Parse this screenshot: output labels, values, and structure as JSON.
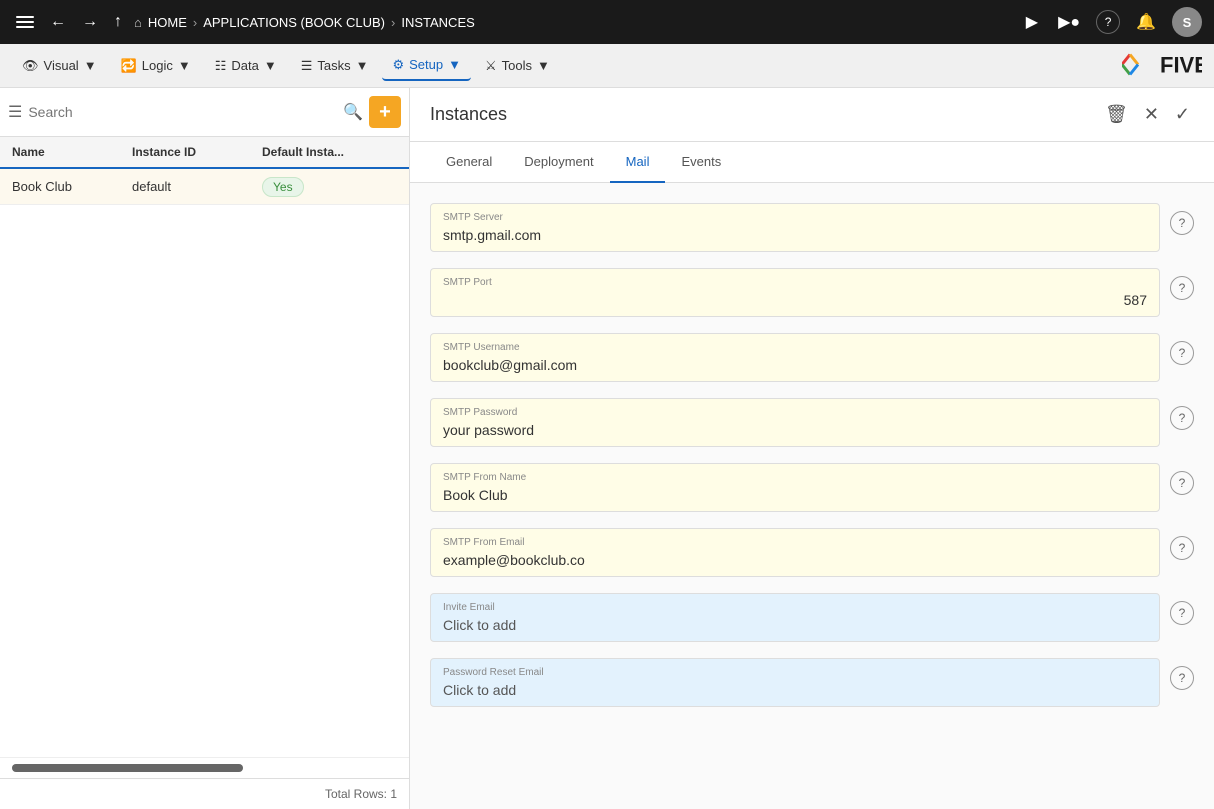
{
  "topNav": {
    "menuIcon": "☰",
    "backIcon": "←",
    "forwardIcon": "→",
    "upIcon": "↑",
    "homeIcon": "⌂",
    "homeLabel": "HOME",
    "sep1": ">",
    "appLabel": "APPLICATIONS (BOOK CLUB)",
    "sep2": ">",
    "instancesLabel": "INSTANCES",
    "playIcon": "▶",
    "recordIcon": "⏺",
    "helpIcon": "?",
    "bellIcon": "🔔",
    "avatarLabel": "S"
  },
  "toolbar": {
    "visual": "Visual",
    "logic": "Logic",
    "data": "Data",
    "tasks": "Tasks",
    "setup": "Setup",
    "tools": "Tools"
  },
  "leftPanel": {
    "searchPlaceholder": "Search",
    "totalRows": "Total Rows: 1",
    "columns": {
      "name": "Name",
      "instanceId": "Instance ID",
      "defaultInstance": "Default Insta..."
    },
    "rows": [
      {
        "name": "Book Club",
        "instanceId": "default",
        "defaultInstance": "Yes"
      }
    ]
  },
  "rightPanel": {
    "title": "Instances",
    "tabs": [
      {
        "label": "General",
        "active": false
      },
      {
        "label": "Deployment",
        "active": false
      },
      {
        "label": "Mail",
        "active": true
      },
      {
        "label": "Events",
        "active": false
      }
    ],
    "fields": [
      {
        "label": "SMTP Server",
        "value": "smtp.gmail.com",
        "bgClass": "yellow-bg"
      },
      {
        "label": "SMTP Port",
        "value": "587",
        "bgClass": "yellow-bg",
        "rightAlign": true
      },
      {
        "label": "SMTP Username",
        "value": "bookclub@gmail.com",
        "bgClass": "yellow-bg"
      },
      {
        "label": "SMTP Password",
        "value": "your password",
        "bgClass": "yellow-bg"
      },
      {
        "label": "SMTP From Name",
        "value": "Book Club",
        "bgClass": "yellow-bg"
      },
      {
        "label": "SMTP From Email",
        "value": "example@bookclub.co",
        "bgClass": "yellow-bg"
      },
      {
        "label": "Invite Email",
        "value": "Click to add",
        "bgClass": "blue-bg"
      },
      {
        "label": "Password Reset Email",
        "value": "Click to add",
        "bgClass": "blue-bg"
      }
    ]
  }
}
